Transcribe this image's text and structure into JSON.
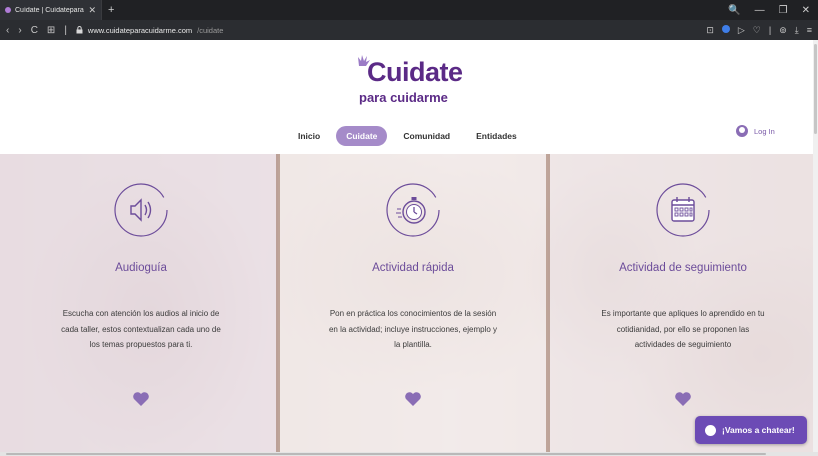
{
  "browser": {
    "tab_title": "Cuídate | Cuídateparacuid...",
    "tab_close": "✕",
    "new_tab": "+",
    "url_host": "www.cuidateparacuidarme.com",
    "url_path": "/cuidate",
    "window_controls": [
      "🔍",
      "—",
      "❐",
      "✕"
    ],
    "nav_buttons": [
      "‹",
      "›",
      "C",
      "⊞",
      "|"
    ],
    "right_icons": [
      "⊡",
      "▷",
      "♡",
      "|",
      "⊚",
      "⤓",
      "≡"
    ]
  },
  "site": {
    "logo_main": "Cuidate",
    "logo_sub": "para cuidarme",
    "nav": [
      "Inicio",
      "Cuidate",
      "Comunidad",
      "Entidades"
    ],
    "nav_active_index": 1,
    "login_label": "Log In"
  },
  "cards": [
    {
      "icon": "speaker-icon",
      "title": "Audioguía",
      "text": "Escucha con atención los audios al inicio de cada taller, estos contextualizan cada uno de los temas propuestos para ti."
    },
    {
      "icon": "stopwatch-icon",
      "title": "Actividad rápida",
      "text": "Pon en práctica los conocimientos de la sesión en la actividad; incluye instrucciones, ejemplo y la plantilla."
    },
    {
      "icon": "calendar-icon",
      "title": "Actividad de seguimiento",
      "text": "Es importante que apliques lo aprendido en tu cotidianidad, por ello se proponen las actividades de seguimiento"
    }
  ],
  "chat": {
    "label": "¡Vamos a chatear!"
  },
  "colors": {
    "brand": "#5b2a86",
    "accent": "#a58bc9",
    "chat": "#6c4bb5",
    "title": "#6c4c9a"
  }
}
